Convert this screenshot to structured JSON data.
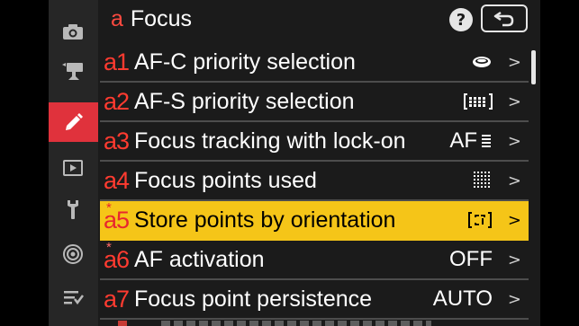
{
  "sidebar": {
    "items": [
      {
        "icon": "camera-icon",
        "active": false
      },
      {
        "icon": "movie-camera-icon",
        "active": false
      },
      {
        "icon": "pencil-icon",
        "active": true
      },
      {
        "icon": "playback-icon",
        "active": false
      },
      {
        "icon": "wrench-icon",
        "active": false
      },
      {
        "icon": "network-icon",
        "active": false
      },
      {
        "icon": "my-menu-icon",
        "active": false
      }
    ]
  },
  "header": {
    "menu_letter": "a",
    "title": "Focus",
    "help_label": "?",
    "back_icon": "back-arrow-icon"
  },
  "menu": {
    "items": [
      {
        "code": "a1",
        "starred": false,
        "label": "AF-C priority selection",
        "value": "",
        "value_icon": "release-priority-icon",
        "selected": false
      },
      {
        "code": "a2",
        "starred": false,
        "label": "AF-S priority selection",
        "value": "",
        "value_icon": "focus-priority-icon",
        "selected": false
      },
      {
        "code": "a3",
        "starred": false,
        "label": "Focus tracking with lock-on",
        "value": "AF",
        "value_icon": "lockon-bars-icon",
        "selected": false
      },
      {
        "code": "a4",
        "starred": false,
        "label": "Focus points used",
        "value": "",
        "value_icon": "focus-grid-icon",
        "selected": false
      },
      {
        "code": "a5",
        "starred": true,
        "label": "Store points by orientation",
        "value": "[ᵗ¹]",
        "value_icon": "",
        "selected": true
      },
      {
        "code": "a6",
        "starred": true,
        "label": "AF activation",
        "value": "OFF",
        "value_icon": "",
        "selected": false
      },
      {
        "code": "a7",
        "starred": false,
        "label": "Focus point persistence",
        "value": "AUTO",
        "value_icon": "",
        "selected": false
      }
    ],
    "chevron": ">",
    "star_glyph": "*"
  },
  "colors": {
    "accent_red": "#e0323c",
    "selection_yellow": "#f5c518",
    "code_red": "#ff3b30",
    "background": "#1b1b1b"
  }
}
